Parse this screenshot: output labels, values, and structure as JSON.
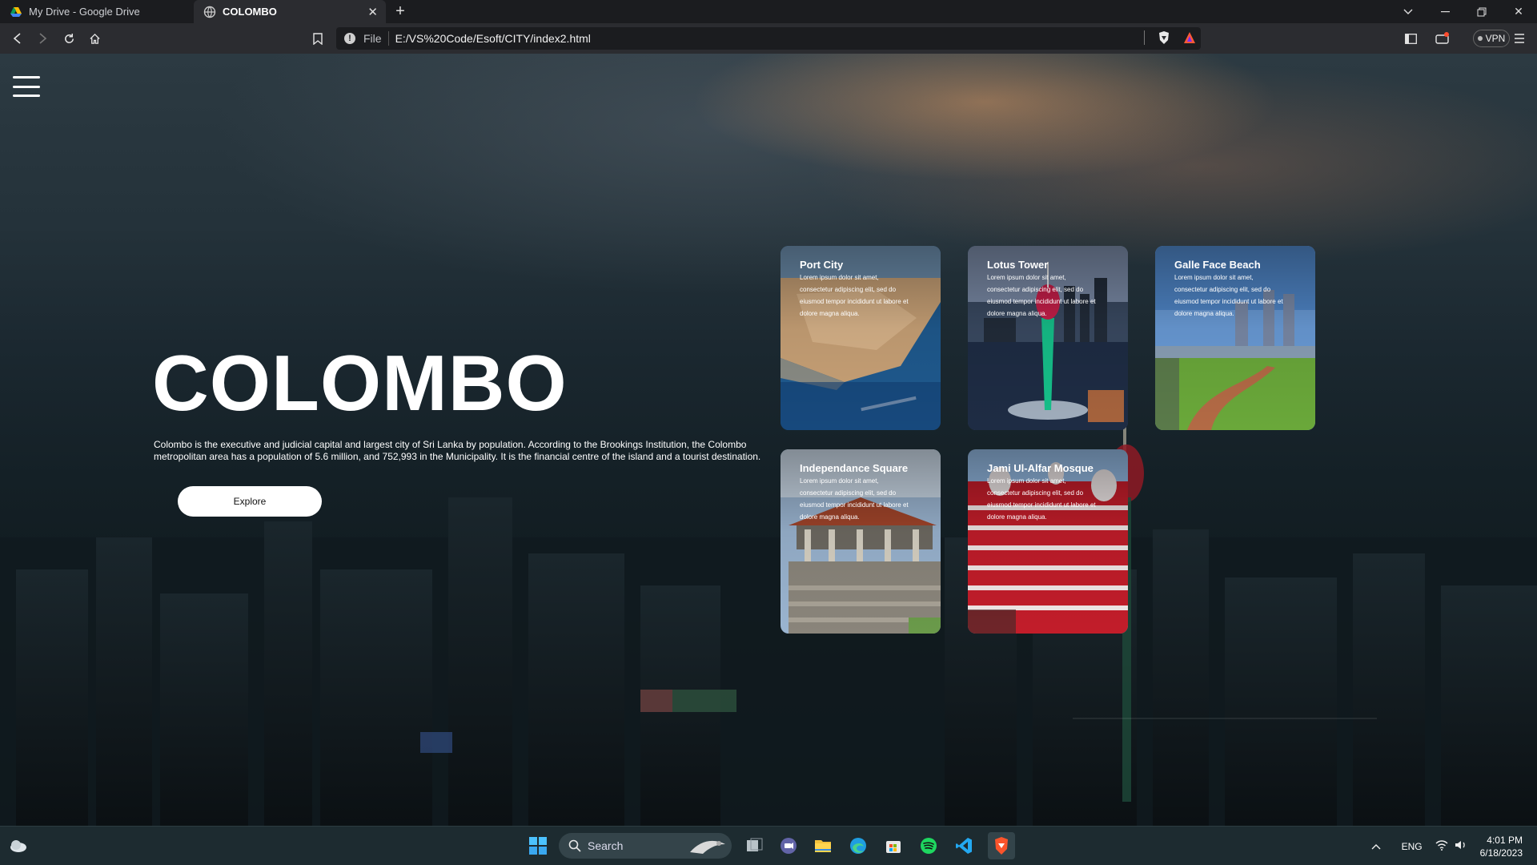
{
  "browser": {
    "tabs": [
      {
        "title": "My Drive - Google Drive",
        "active": false
      },
      {
        "title": "COLOMBO",
        "active": true
      }
    ],
    "new_tab_label": "+",
    "url_scheme": "File",
    "url": "E:/VS%20Code/Esoft/CITY/index2.html",
    "vpn_label": "VPN"
  },
  "page": {
    "title": "COLOMBO",
    "description": "Colombo is the executive and judicial capital and largest city of Sri Lanka by population. According to the Brookings Institution, the Colombo metropolitan area has a population of 5.6 million, and 752,993 in the Municipality. It is the financial centre of the island and a tourist destination.",
    "explore_label": "Explore",
    "cards": [
      {
        "title": "Port City",
        "text": "Lorem ipsum dolor sit amet, consectetur adipiscing elit, sed do eiusmod tempor incididunt ut labore et dolore magna aliqua."
      },
      {
        "title": "Lotus Tower",
        "text": "Lorem ipsum dolor sit amet, consectetur adipiscing elit, sed do eiusmod tempor incididunt ut labore et dolore magna aliqua."
      },
      {
        "title": "Galle Face Beach",
        "text": "Lorem ipsum dolor sit amet, consectetur adipiscing elit, sed do eiusmod tempor incididunt ut labore et dolore magna aliqua."
      },
      {
        "title": "Independance Square",
        "text": "Lorem ipsum dolor sit amet, consectetur adipiscing elit, sed do eiusmod tempor incididunt ut labore et dolore magna aliqua."
      },
      {
        "title": "Jami Ul-Alfar Mosque",
        "text": "Lorem ipsum dolor sit amet, consectetur adipiscing elit, sed do eiusmod tempor incididunt ut labore et dolore magna aliqua."
      }
    ]
  },
  "taskbar": {
    "search_placeholder": "Search",
    "language": "ENG",
    "time": "4:01 PM",
    "date": "6/18/2023"
  },
  "colors": {
    "accent": "#ffffff",
    "taskbar": "#1d2b30",
    "chrome": "#2b2c30"
  }
}
